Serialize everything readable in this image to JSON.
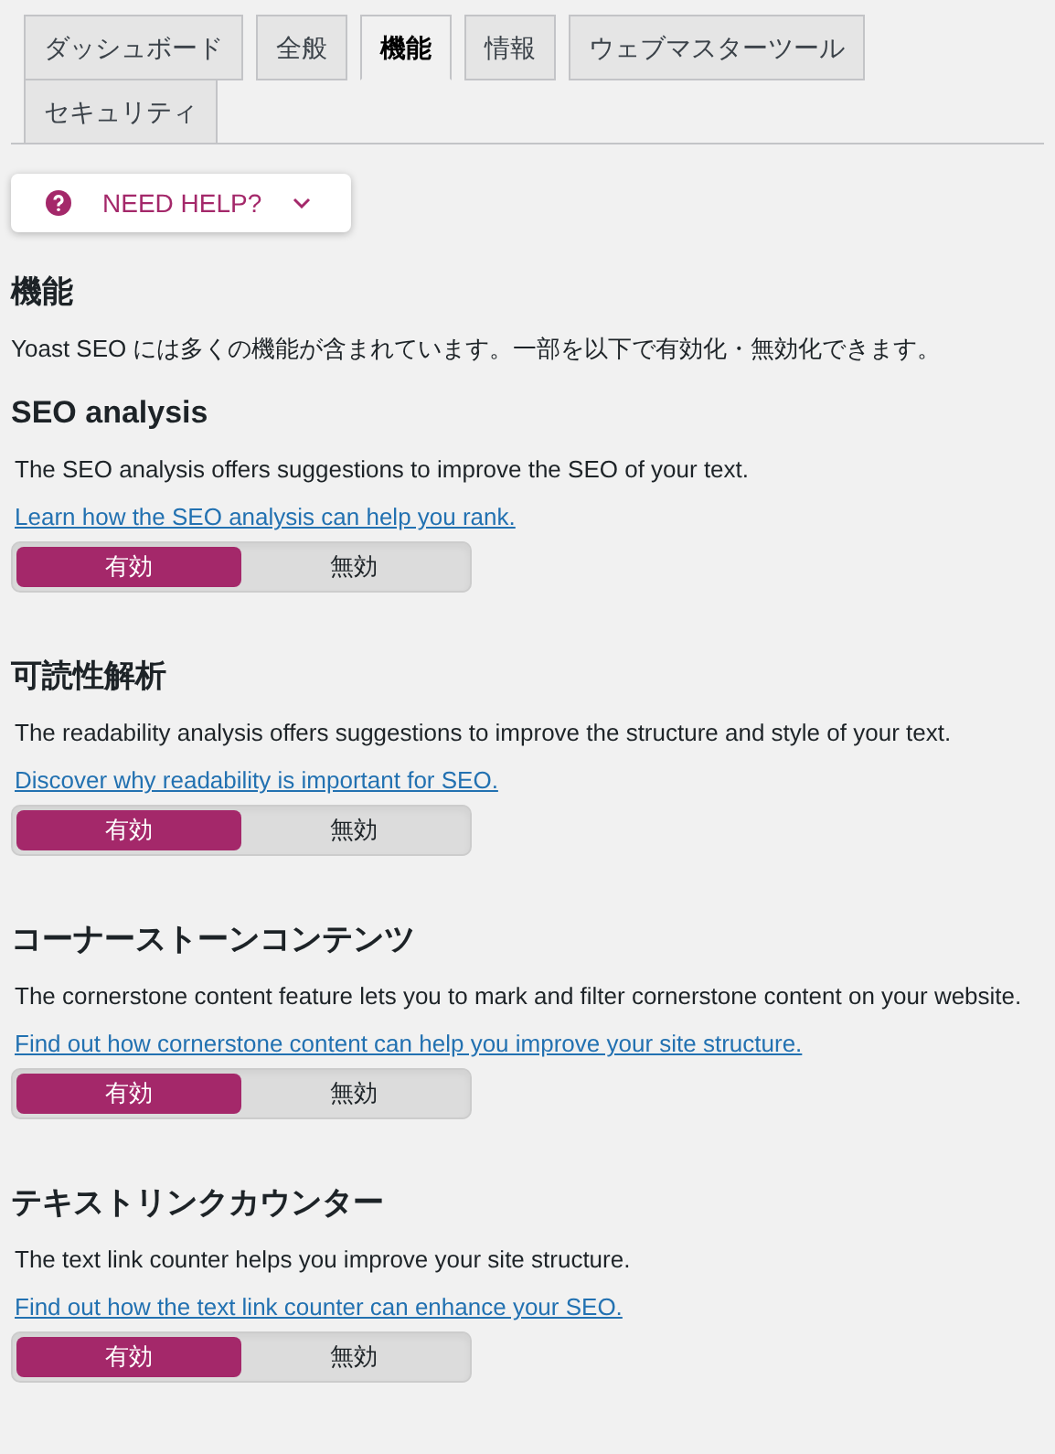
{
  "tabs": [
    {
      "label": "ダッシュボード",
      "selected": false
    },
    {
      "label": "全般",
      "selected": false
    },
    {
      "label": "機能",
      "selected": true
    },
    {
      "label": "情報",
      "selected": false
    },
    {
      "label": "ウェブマスターツール",
      "selected": false
    },
    {
      "label": "セキュリティ",
      "selected": false
    }
  ],
  "help_button": {
    "label": "NEED HELP?",
    "expanded": false
  },
  "page_title": "機能",
  "intro": "Yoast SEO には多くの機能が含まれています。一部を以下で有効化・無効化できます。",
  "features": [
    {
      "title": "SEO analysis",
      "description": "The SEO analysis offers suggestions to improve the SEO of your text.",
      "link": "Learn how the SEO analysis can help you rank.",
      "options": [
        {
          "label": "有効",
          "selected": true
        },
        {
          "label": "無効",
          "selected": false
        }
      ]
    },
    {
      "title": "可読性解析",
      "description": "The readability analysis offers suggestions to improve the structure and style of your text.",
      "link": "Discover why readability is important for SEO.",
      "options": [
        {
          "label": "有効",
          "selected": true
        },
        {
          "label": "無効",
          "selected": false
        }
      ]
    },
    {
      "title": "コーナーストーンコンテンツ",
      "description": "The cornerstone content feature lets you to mark and filter cornerstone content on your website.",
      "link": "Find out how cornerstone content can help you improve your site structure.",
      "options": [
        {
          "label": "有効",
          "selected": true
        },
        {
          "label": "無効",
          "selected": false
        }
      ]
    },
    {
      "title": "テキストリンクカウンター",
      "description": "The text link counter helps you improve your site structure.",
      "link": "Find out how the text link counter can enhance your SEO.",
      "options": [
        {
          "label": "有効",
          "selected": true
        },
        {
          "label": "無効",
          "selected": false
        }
      ]
    }
  ]
}
